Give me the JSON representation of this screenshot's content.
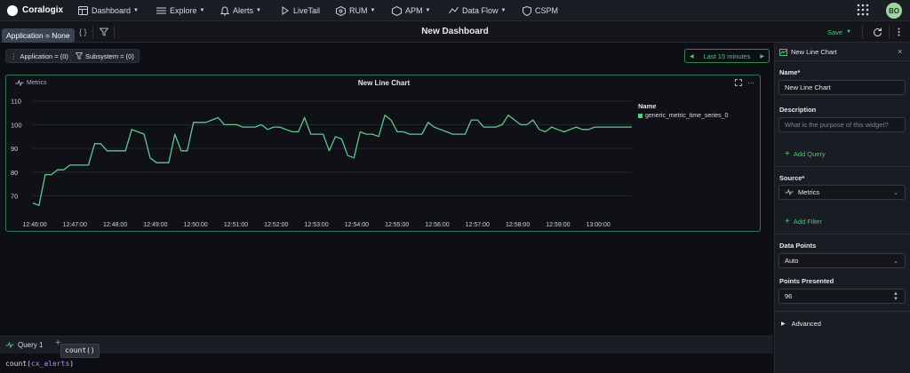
{
  "app": {
    "name": "Coralogix"
  },
  "nav": {
    "items": [
      {
        "label": "Dashboard",
        "icon": "dashboard-icon",
        "caret": true
      },
      {
        "label": "Explore",
        "icon": "explore-icon",
        "caret": true
      },
      {
        "label": "Alerts",
        "icon": "bell-icon",
        "caret": true
      },
      {
        "label": "LiveTail",
        "icon": "livetail-icon",
        "caret": false
      },
      {
        "label": "RUM",
        "icon": "rum-icon",
        "caret": true
      },
      {
        "label": "APM",
        "icon": "apm-icon",
        "caret": true
      },
      {
        "label": "Data Flow",
        "icon": "dataflow-icon",
        "caret": true
      },
      {
        "label": "CSPM",
        "icon": "shield-icon",
        "caret": false
      }
    ],
    "avatar": "BO"
  },
  "toolbar": {
    "tooltip": "Application = None",
    "json_label": "{ }",
    "title": "New Dashboard",
    "save_label": "Save"
  },
  "filters": {
    "application": "Application = (0)",
    "subsystem": "Subsystem = (0)",
    "time_range": "Last 15 minutes"
  },
  "widget": {
    "badge": "Metrics",
    "title": "New Line Chart"
  },
  "chart_data": {
    "type": "line",
    "title": "New Line Chart",
    "xlabel": "",
    "ylabel": "",
    "ylim": [
      62,
      114
    ],
    "yticks": [
      70,
      80,
      90,
      100,
      110
    ],
    "xticks": [
      "12:46:00",
      "12:47:00",
      "12:48:00",
      "12:49:00",
      "12:50:00",
      "12:51:00",
      "12:52:00",
      "12:53:00",
      "12:54:00",
      "12:55:00",
      "12:56:00",
      "12:57:00",
      "12:58:00",
      "12:59:00",
      "13:00:00"
    ],
    "grid": true,
    "legend": {
      "title": "Name",
      "placement": "right"
    },
    "series": [
      {
        "name": "generic_metric_time_series_0",
        "color": "#63c78a",
        "values": [
          67,
          66,
          79,
          79,
          81,
          81,
          83,
          83,
          83,
          83,
          92,
          92,
          89,
          89,
          89,
          89,
          98,
          97,
          96,
          86,
          84,
          84,
          84,
          96,
          89,
          89,
          101,
          101,
          101,
          102,
          103,
          100,
          100,
          100,
          99,
          99,
          99,
          100,
          98,
          99,
          99,
          98,
          97,
          97,
          103,
          96,
          96,
          96,
          89,
          95,
          94,
          87,
          86,
          97,
          96,
          96,
          95,
          104,
          102,
          97,
          97,
          96,
          96,
          96,
          101,
          99,
          98,
          97,
          96,
          96,
          96,
          102,
          102,
          99,
          99,
          99,
          100,
          104,
          102,
          100,
          100,
          102,
          98,
          97,
          99,
          98,
          97,
          98,
          99,
          98,
          98,
          99,
          99,
          99,
          99,
          99,
          99,
          99
        ]
      }
    ]
  },
  "query": {
    "tab_label": "Query 1",
    "autocomplete": "count()",
    "code_fn": "count(",
    "code_arg": "cx_alerts",
    "code_end": ")"
  },
  "panel": {
    "header": "New Line Chart",
    "name_label": "Name*",
    "name_value": "New Line Chart",
    "description_label": "Description",
    "description_placeholder": "What is the purpose of this widget?",
    "add_query": "Add Query",
    "source_label": "Source*",
    "source_value": "Metrics",
    "add_filter": "Add Filter",
    "data_points_label": "Data Points",
    "data_points_value": "Auto",
    "points_presented_label": "Points Presented",
    "points_presented_value": "96",
    "advanced_label": "Advanced"
  }
}
